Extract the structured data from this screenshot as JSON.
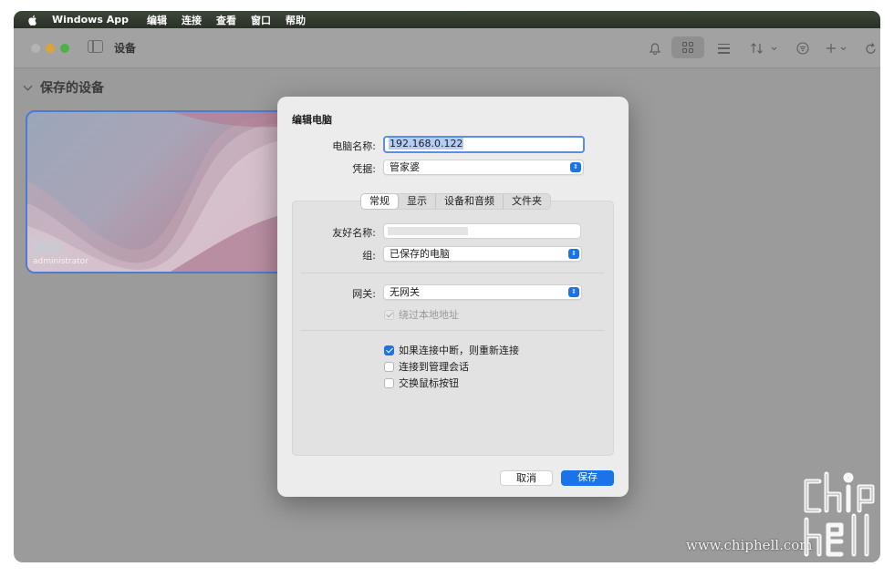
{
  "menubar": {
    "app_name": "Windows App",
    "items": [
      "编辑",
      "连接",
      "查看",
      "窗口",
      "帮助"
    ]
  },
  "window": {
    "title": "设备",
    "section_title": "保存的设备",
    "device_card": {
      "username": "administrator"
    }
  },
  "dialog": {
    "title": "编辑电脑",
    "pc_name_label": "电脑名称:",
    "pc_name_value": "192.168.0.122",
    "credentials_label": "凭据:",
    "credentials_value": "管家婆",
    "tabs": [
      "常规",
      "显示",
      "设备和音频",
      "文件夹"
    ],
    "active_tab": "常规",
    "friendly_name_label": "友好名称:",
    "group_label": "组:",
    "group_value": "已保存的电脑",
    "gateway_label": "网关:",
    "gateway_value": "无网关",
    "bypass_local": "绕过本地地址",
    "reconnect": "如果连接中断，则重新连接",
    "admin_session": "连接到管理会话",
    "swap_mouse": "交换鼠标按钮",
    "cancel": "取消",
    "save": "保存"
  },
  "watermark": {
    "text": "www.chiphell.com"
  },
  "colors": {
    "accent": "#1a73e8",
    "menubar": "#2f362c",
    "window_bg": "#9b9b9b"
  }
}
